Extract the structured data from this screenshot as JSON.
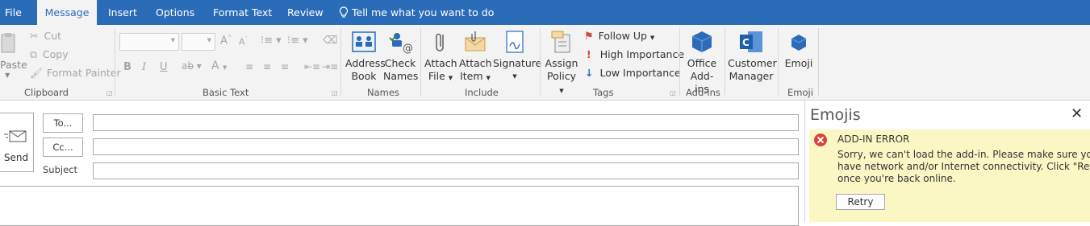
{
  "tabs": [
    "File",
    "Message",
    "Insert",
    "Options",
    "Format Text",
    "Review"
  ],
  "tell_me": "Tell me what you want to do",
  "clipboard": {
    "paste": "Paste",
    "cut": "Cut",
    "copy": "Copy",
    "format_painter": "Format Painter",
    "label": "Clipboard"
  },
  "basic_text": {
    "bold": "B",
    "italic": "I",
    "underline": "U",
    "font_color": "A",
    "label": "Basic Text"
  },
  "names": {
    "address_book": [
      "Address",
      "Book"
    ],
    "check_names": [
      "Check",
      "Names"
    ],
    "label": "Names"
  },
  "include": {
    "attach_file": [
      "Attach",
      "File"
    ],
    "attach_item": [
      "Attach",
      "Item"
    ],
    "signature": "Signature",
    "label": "Include"
  },
  "tags": {
    "assign_policy": [
      "Assign",
      "Policy"
    ],
    "follow_up": "Follow Up",
    "high_importance": "High Importance",
    "low_importance": "Low Importance",
    "label": "Tags"
  },
  "addins": {
    "office_addins": [
      "Office",
      "Add-ins"
    ],
    "label": "Add-ins"
  },
  "customer_manager": [
    "Customer",
    "Manager"
  ],
  "emoji": {
    "button": "Emoji",
    "label": "Emoji"
  },
  "compose": {
    "send": "Send",
    "to": "To...",
    "cc": "Cc...",
    "subject": "Subject"
  },
  "emoji_pane": {
    "title": "Emojis",
    "error_title": "ADD-IN ERROR",
    "error_lines": [
      "Sorry, we can't load the add-in. Please make sure you",
      "have network and/or Internet connectivity. Click \"Retry\"",
      "once you're back online."
    ],
    "retry": "Retry"
  },
  "colors": {
    "accent": "#2b6cb9",
    "ribbon_bg": "#f3f3f3",
    "error_bg": "#fbf7c4",
    "error_icon": "#d9443a"
  }
}
